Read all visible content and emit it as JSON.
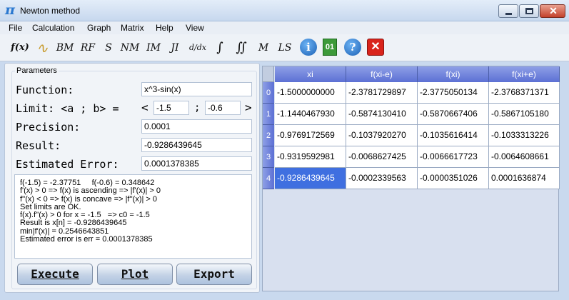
{
  "window": {
    "title": "Newton method",
    "app_icon_glyph": "π",
    "close_glyph": "✕"
  },
  "menu": [
    "File",
    "Calculation",
    "Graph",
    "Matrix",
    "Help",
    "View"
  ],
  "toolbar": {
    "items": [
      "f(x)",
      "∿",
      "BM",
      "RF",
      "S",
      "NM",
      "IM",
      "JI",
      "d/dx",
      "∫",
      "∬",
      "M",
      "LS"
    ],
    "info_glyph": "i",
    "doc_glyph": "01",
    "help_glyph": "?",
    "exit_glyph": "✕"
  },
  "params": {
    "group_title": "Parameters",
    "function_label": "Function:",
    "function_value": "x^3-sin(x)",
    "limit_label": "Limit: <a ; b> =",
    "limit_open": "<",
    "limit_sep": ";",
    "limit_close": ">",
    "limit_a": "-1.5",
    "limit_b": "-0.6",
    "precision_label": "Precision:",
    "precision_value": "0.0001",
    "result_label": "Result:",
    "result_value": "-0.9286439645",
    "error_label": "Estimated Error:",
    "error_value": "0.0001378385"
  },
  "log": [
    "f(-1.5) = -2.37751     f(-0.6) = 0.348642",
    "f'(x) > 0 => f(x) is ascending => |f'(x)| > 0",
    "f''(x) < 0 => f(x) is concave => |f''(x)| > 0",
    "Set limits are OK.",
    "f(x).f''(x) > 0 for x = -1.5   => c0 = -1.5",
    "Result is x[n] = -0.9286439645",
    "min|f'(x)| = 0.2546643851",
    "Estimated error is err = 0.0001378385"
  ],
  "buttons": {
    "execute": "Execute",
    "plot": "Plot",
    "export": "Export"
  },
  "grid": {
    "columns": [
      "xi",
      "f(xi-e)",
      "f(xi)",
      "f(xi+e)"
    ],
    "rows": [
      {
        "index": "0",
        "cells": [
          "-1.5000000000",
          "-2.3781729897",
          "-2.3775050134",
          "-2.3768371371"
        ]
      },
      {
        "index": "1",
        "cells": [
          "-1.1440467930",
          "-0.5874130410",
          "-0.5870667406",
          "-0.5867105180"
        ]
      },
      {
        "index": "2",
        "cells": [
          "-0.9769172569",
          "-0.1037920270",
          "-0.1035616414",
          "-0.1033313226"
        ]
      },
      {
        "index": "3",
        "cells": [
          "-0.9319592981",
          "-0.0068627425",
          "-0.0066617723",
          "-0.0064608661"
        ]
      },
      {
        "index": "4",
        "cells": [
          "-0.9286439645",
          "-0.0002339563",
          "-0.0000351026",
          "0.0001636874"
        ]
      }
    ],
    "selected_row": 4,
    "selected_col": 0
  }
}
